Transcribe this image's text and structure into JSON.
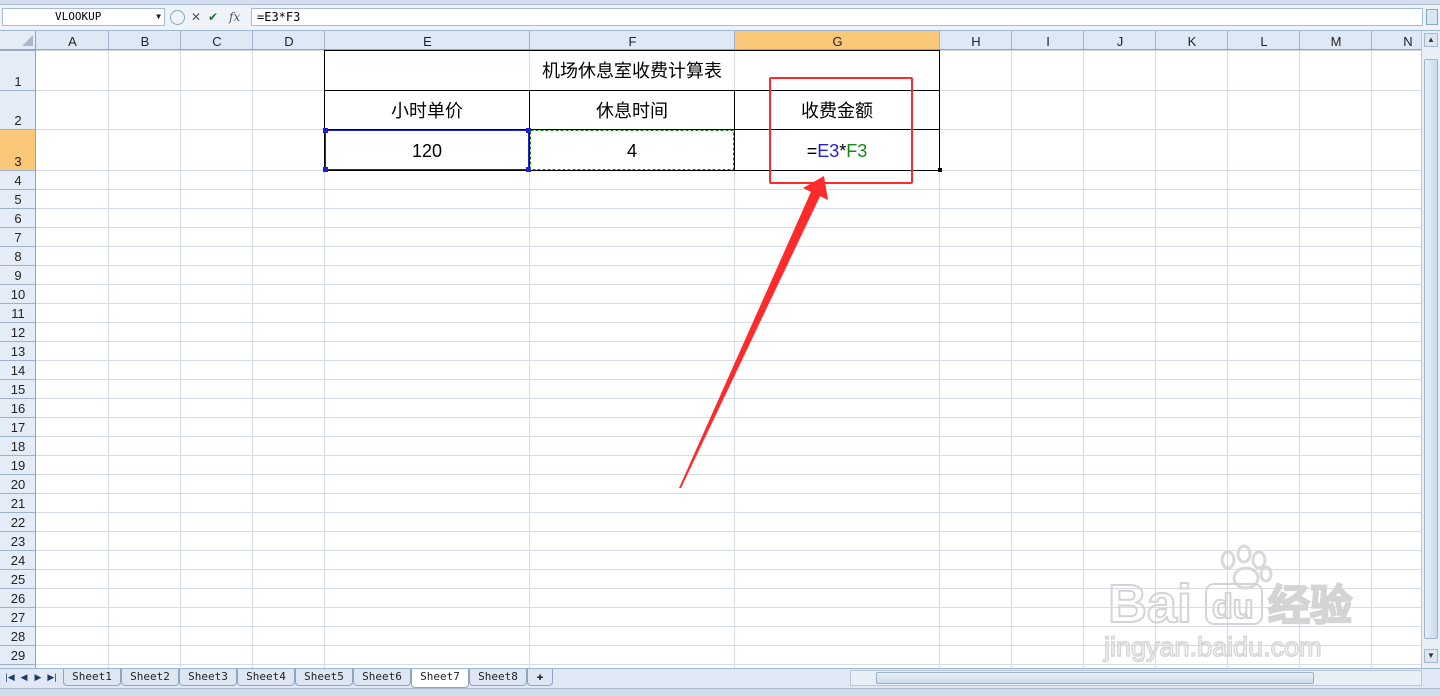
{
  "formula_bar": {
    "name_box": "VLOOKUP",
    "cancel_glyph": "✕",
    "enter_glyph": "✔",
    "fx_label": "fx",
    "formula": "=E3*F3"
  },
  "columns": [
    "A",
    "B",
    "C",
    "D",
    "E",
    "F",
    "G",
    "H",
    "I",
    "J",
    "K",
    "L",
    "M",
    "N"
  ],
  "rows": [
    "1",
    "2",
    "3",
    "4",
    "5",
    "6",
    "7",
    "8",
    "9",
    "10",
    "11",
    "12",
    "13",
    "14",
    "15",
    "16",
    "17",
    "18",
    "19",
    "20",
    "21",
    "22",
    "23",
    "24",
    "25",
    "26",
    "27",
    "28",
    "29"
  ],
  "table": {
    "title": "机场休息室收费计算表",
    "headers": [
      "小时单价",
      "休息时间",
      "收费金额"
    ],
    "values": {
      "E3": "120",
      "F3": "4"
    },
    "formula_cell": {
      "eq": "=",
      "ref1": "E3",
      "op": "*",
      "ref2": "F3"
    }
  },
  "sheet_tabs": [
    "Sheet1",
    "Sheet2",
    "Sheet3",
    "Sheet4",
    "Sheet5",
    "Sheet6",
    "Sheet7",
    "Sheet8"
  ],
  "active_sheet": "Sheet7",
  "watermark": {
    "brand_latin": "Bai",
    "brand_du": "du",
    "brand_cn": "经验",
    "domain": "jingyan.baidu.com"
  },
  "colors": {
    "ref1": "#1f1fd8",
    "ref2": "#128a12",
    "highlight": "#ff2a2a",
    "selected_header": "#f9c878"
  },
  "icons": {
    "sheet_nav": [
      "first-sheet-icon",
      "prev-sheet-icon",
      "next-sheet-icon",
      "last-sheet-icon"
    ],
    "insert_sheet": "insert-sheet-icon"
  }
}
